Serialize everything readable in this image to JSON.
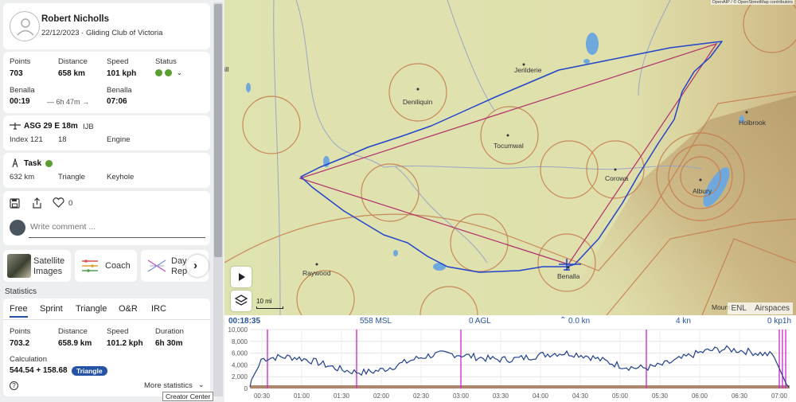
{
  "pilot": {
    "name": "Robert Nicholls",
    "meta": "22/12/2023 · Gliding Club of Victoria"
  },
  "summary": {
    "points_label": "Points",
    "points": "703",
    "distance_label": "Distance",
    "distance": "658 km",
    "speed_label": "Speed",
    "speed": "101 kph",
    "status_label": "Status",
    "from_place": "Benalla",
    "from_time": "00:19",
    "duration": "— 6h 47m →",
    "to_place": "Benalla",
    "to_time": "07:06"
  },
  "glider": {
    "model": "ASG 29 E 18m",
    "reg": "IJB",
    "index": "Index 121",
    "class": "18",
    "engine": "Engine"
  },
  "task": {
    "title": "Task",
    "distance": "632 km",
    "type": "Triangle",
    "sector": "Keyhole"
  },
  "social": {
    "likes": "0",
    "comment_placeholder": "Write comment ..."
  },
  "apps": [
    {
      "label1": "Satellite",
      "label2": "Images"
    },
    {
      "label1": "Coach",
      "label2": ""
    },
    {
      "label1": "Day",
      "label2": "Rep"
    }
  ],
  "stats": {
    "heading": "Statistics",
    "tabs": [
      "Free",
      "Sprint",
      "Triangle",
      "O&R",
      "IRC"
    ],
    "points_label": "Points",
    "points": "703.2",
    "distance_label": "Distance",
    "distance": "658.9 km",
    "speed_label": "Speed",
    "speed": "101.2 kph",
    "duration_label": "Duration",
    "duration": "6h 30m",
    "calc_label": "Calculation",
    "calc": "544.54 + 158.68",
    "calc_tag": "Triangle",
    "more": "More statistics",
    "help": "?",
    "tooltip": "Creator Center"
  },
  "map": {
    "attribution": "OpenAIP / © OpenStreetMap contributors",
    "scale": "10 mi",
    "towns": [
      "Jerilderie",
      "Deniliquin",
      "Tocumwal",
      "Holbrook",
      "Corowa",
      "Albury",
      "Raywood",
      "Benalla",
      "Mount"
    ],
    "left_edge_text": "ill",
    "tabs": [
      "ENL",
      "Airspaces"
    ]
  },
  "baro": {
    "time": "00:18:35",
    "msl": "558 MSL",
    "agl": "0 AGL",
    "vario": "0.0 kn",
    "wind": "4 kn",
    "right": "0 kp1h",
    "y_ticks": [
      "10,000",
      "8,000",
      "6,000",
      "4,000",
      "2,000",
      "0"
    ],
    "x_ticks": [
      "00:30",
      "01:00",
      "01:30",
      "02:00",
      "02:30",
      "03:00",
      "03:30",
      "04:00",
      "04:30",
      "05:00",
      "05:30",
      "06:00",
      "06:30",
      "07:00"
    ]
  },
  "colors": {
    "accent": "#2553a6",
    "status_ok": "#5a9e2f",
    "track": "#2244cc",
    "task": "#b0306a",
    "airspace": "#c47a4a"
  }
}
